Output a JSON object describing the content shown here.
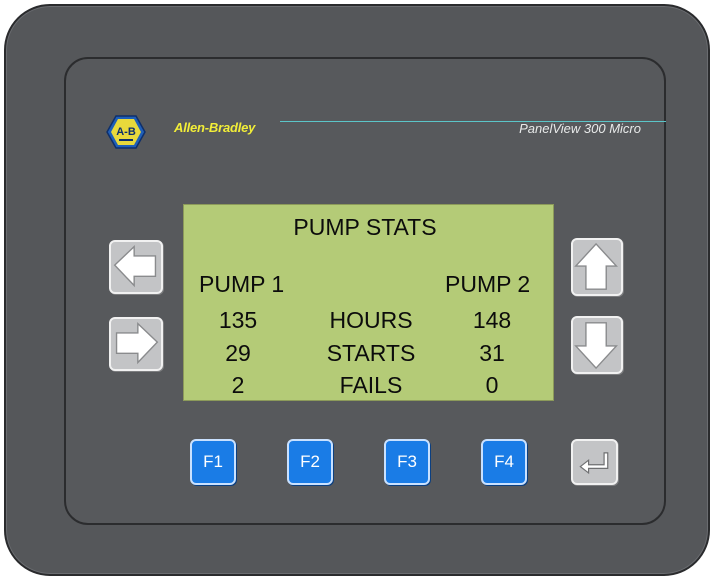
{
  "brand": {
    "logo_text": "A-B",
    "maker": "Allen-Bradley",
    "model": "PanelView 300 Micro",
    "accent": "#f2ee38",
    "line_color": "#5bc5c8"
  },
  "screen": {
    "title": "PUMP STATS",
    "pump1_header": "PUMP 1",
    "pump2_header": "PUMP 2",
    "rows": [
      {
        "pump1": "135",
        "label": "HOURS",
        "pump2": "148"
      },
      {
        "pump1": "29",
        "label": "STARTS",
        "pump2": "31"
      },
      {
        "pump1": "2",
        "label": "FAILS",
        "pump2": "0"
      }
    ],
    "background": "#b4cb77"
  },
  "keys": {
    "left": "left-arrow-icon",
    "right": "right-arrow-icon",
    "up": "up-arrow-icon",
    "down": "down-arrow-icon",
    "enter": "enter-icon",
    "function_keys": [
      "F1",
      "F2",
      "F3",
      "F4"
    ],
    "function_key_color": "#1a7ce6"
  }
}
